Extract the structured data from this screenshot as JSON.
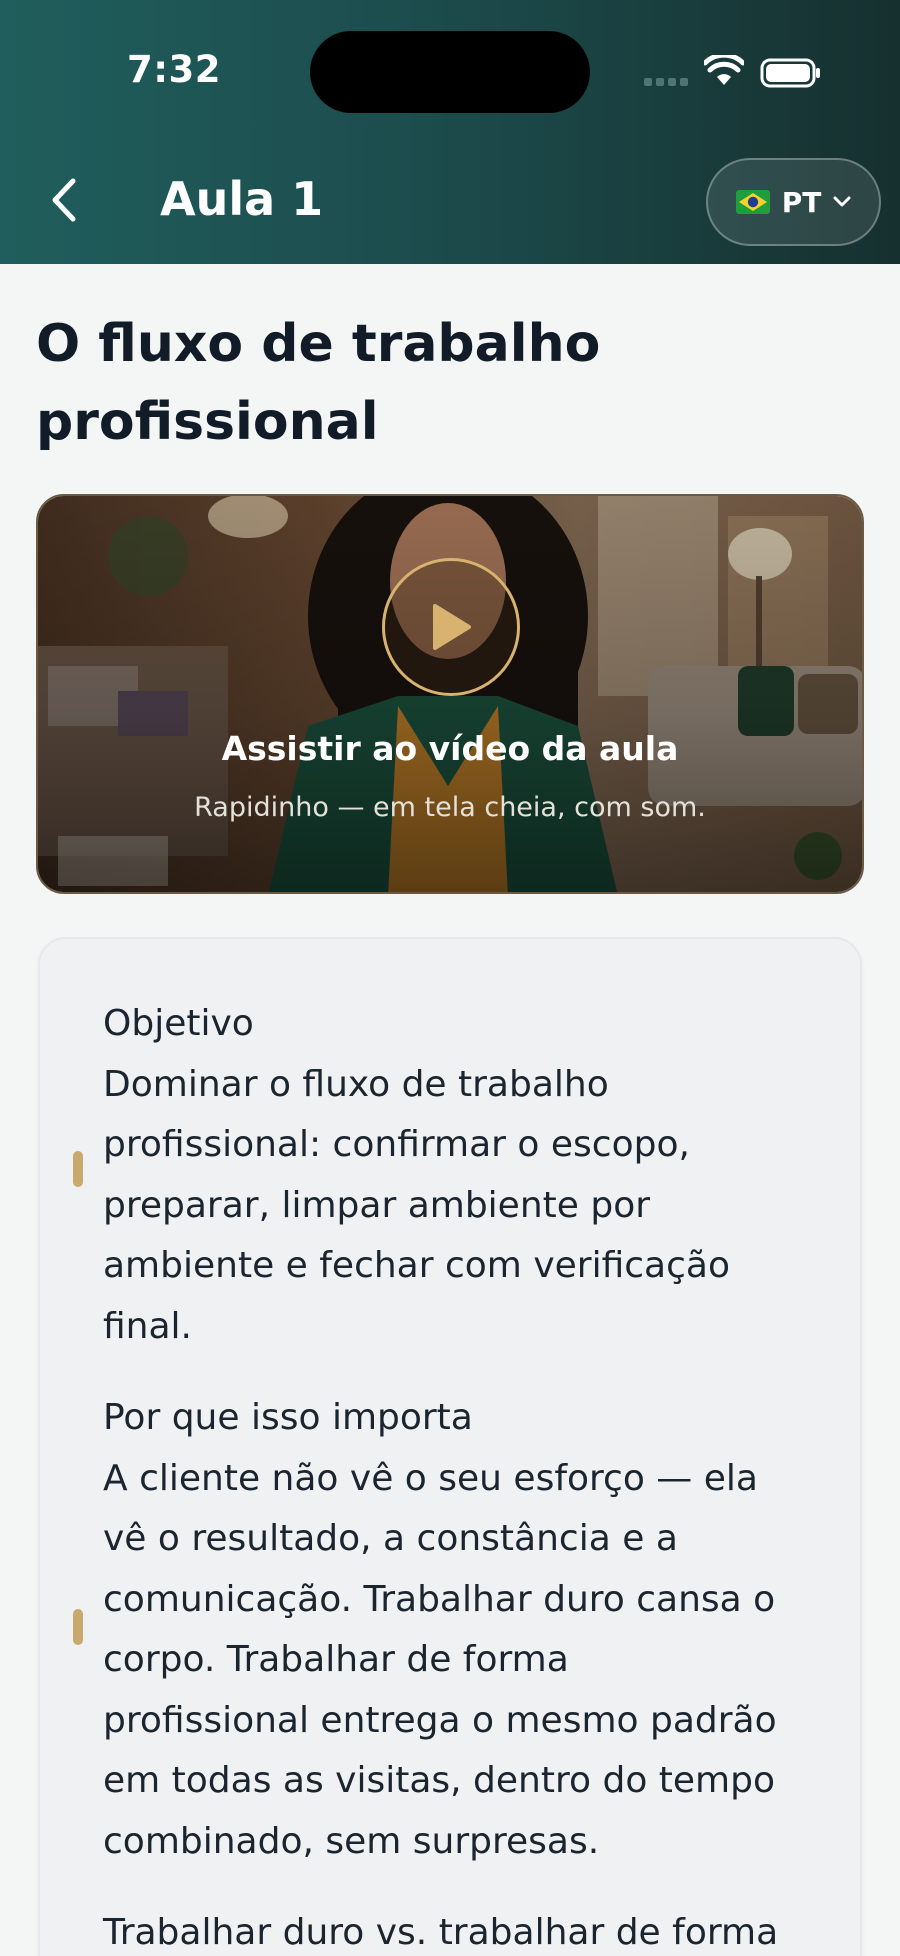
{
  "status_bar": {
    "time": "7:32"
  },
  "header": {
    "title": "Aula 1",
    "language": {
      "flag": "brazil-flag-icon",
      "label": "PT"
    }
  },
  "lesson": {
    "title_line1": "O fluxo de trabalho",
    "title_line2": "profissional"
  },
  "video": {
    "title": "Assistir ao vídeo da aula",
    "subtitle": "Rapidinho — em tela cheia, com som."
  },
  "content": {
    "sections": [
      {
        "heading": "Objetivo",
        "lines": [
          "Dominar o fluxo de trabalho",
          "profissional: confirmar o escopo,",
          "preparar, limpar ambiente por",
          "ambiente e fechar com verificação",
          "final."
        ]
      },
      {
        "heading": "Por que isso importa",
        "lines": [
          "A cliente não vê o seu esforço — ela",
          "vê o resultado, a constância e a",
          "comunicação. Trabalhar duro cansa o",
          "corpo. Trabalhar de forma",
          "profissional entrega o mesmo padrão",
          "em todas as visitas, dentro do tempo",
          "combinado, sem surpresas."
        ]
      },
      {
        "heading": "Trabalhar duro vs. trabalhar de forma"
      }
    ]
  },
  "colors": {
    "header_start": "#1f5e5c",
    "header_end": "#16302f",
    "accent_gold": "#c9a96c",
    "text_dark": "#111c28"
  }
}
